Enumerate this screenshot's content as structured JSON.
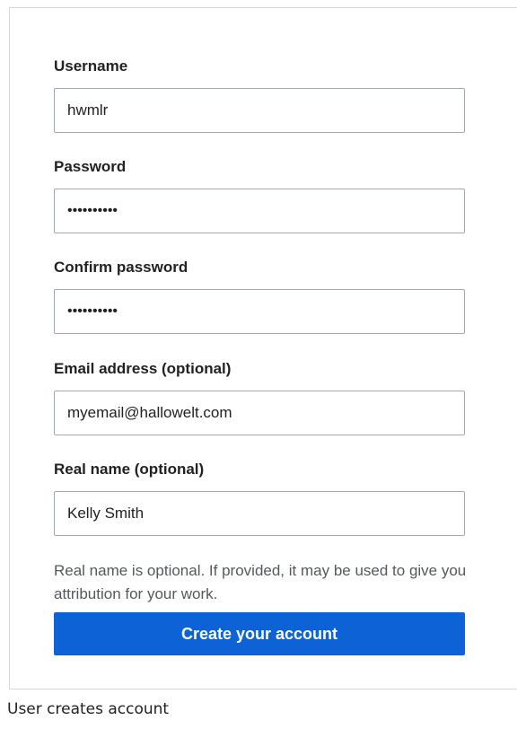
{
  "form": {
    "username": {
      "label": "Username",
      "value": "hwmlr"
    },
    "password": {
      "label": "Password",
      "value": "••••••••••"
    },
    "confirm_password": {
      "label": "Confirm password",
      "value": "••••••••••"
    },
    "email": {
      "label": "Email address (optional)",
      "value": "myemail@hallowelt.com"
    },
    "real_name": {
      "label": "Real name (optional)",
      "value": "Kelly Smith"
    },
    "help_text": "Real name is optional. If provided, it may be used to give you attribution for your work.",
    "submit_label": "Create your account",
    "submit_color": "#0d63d6"
  },
  "caption": "User creates account"
}
